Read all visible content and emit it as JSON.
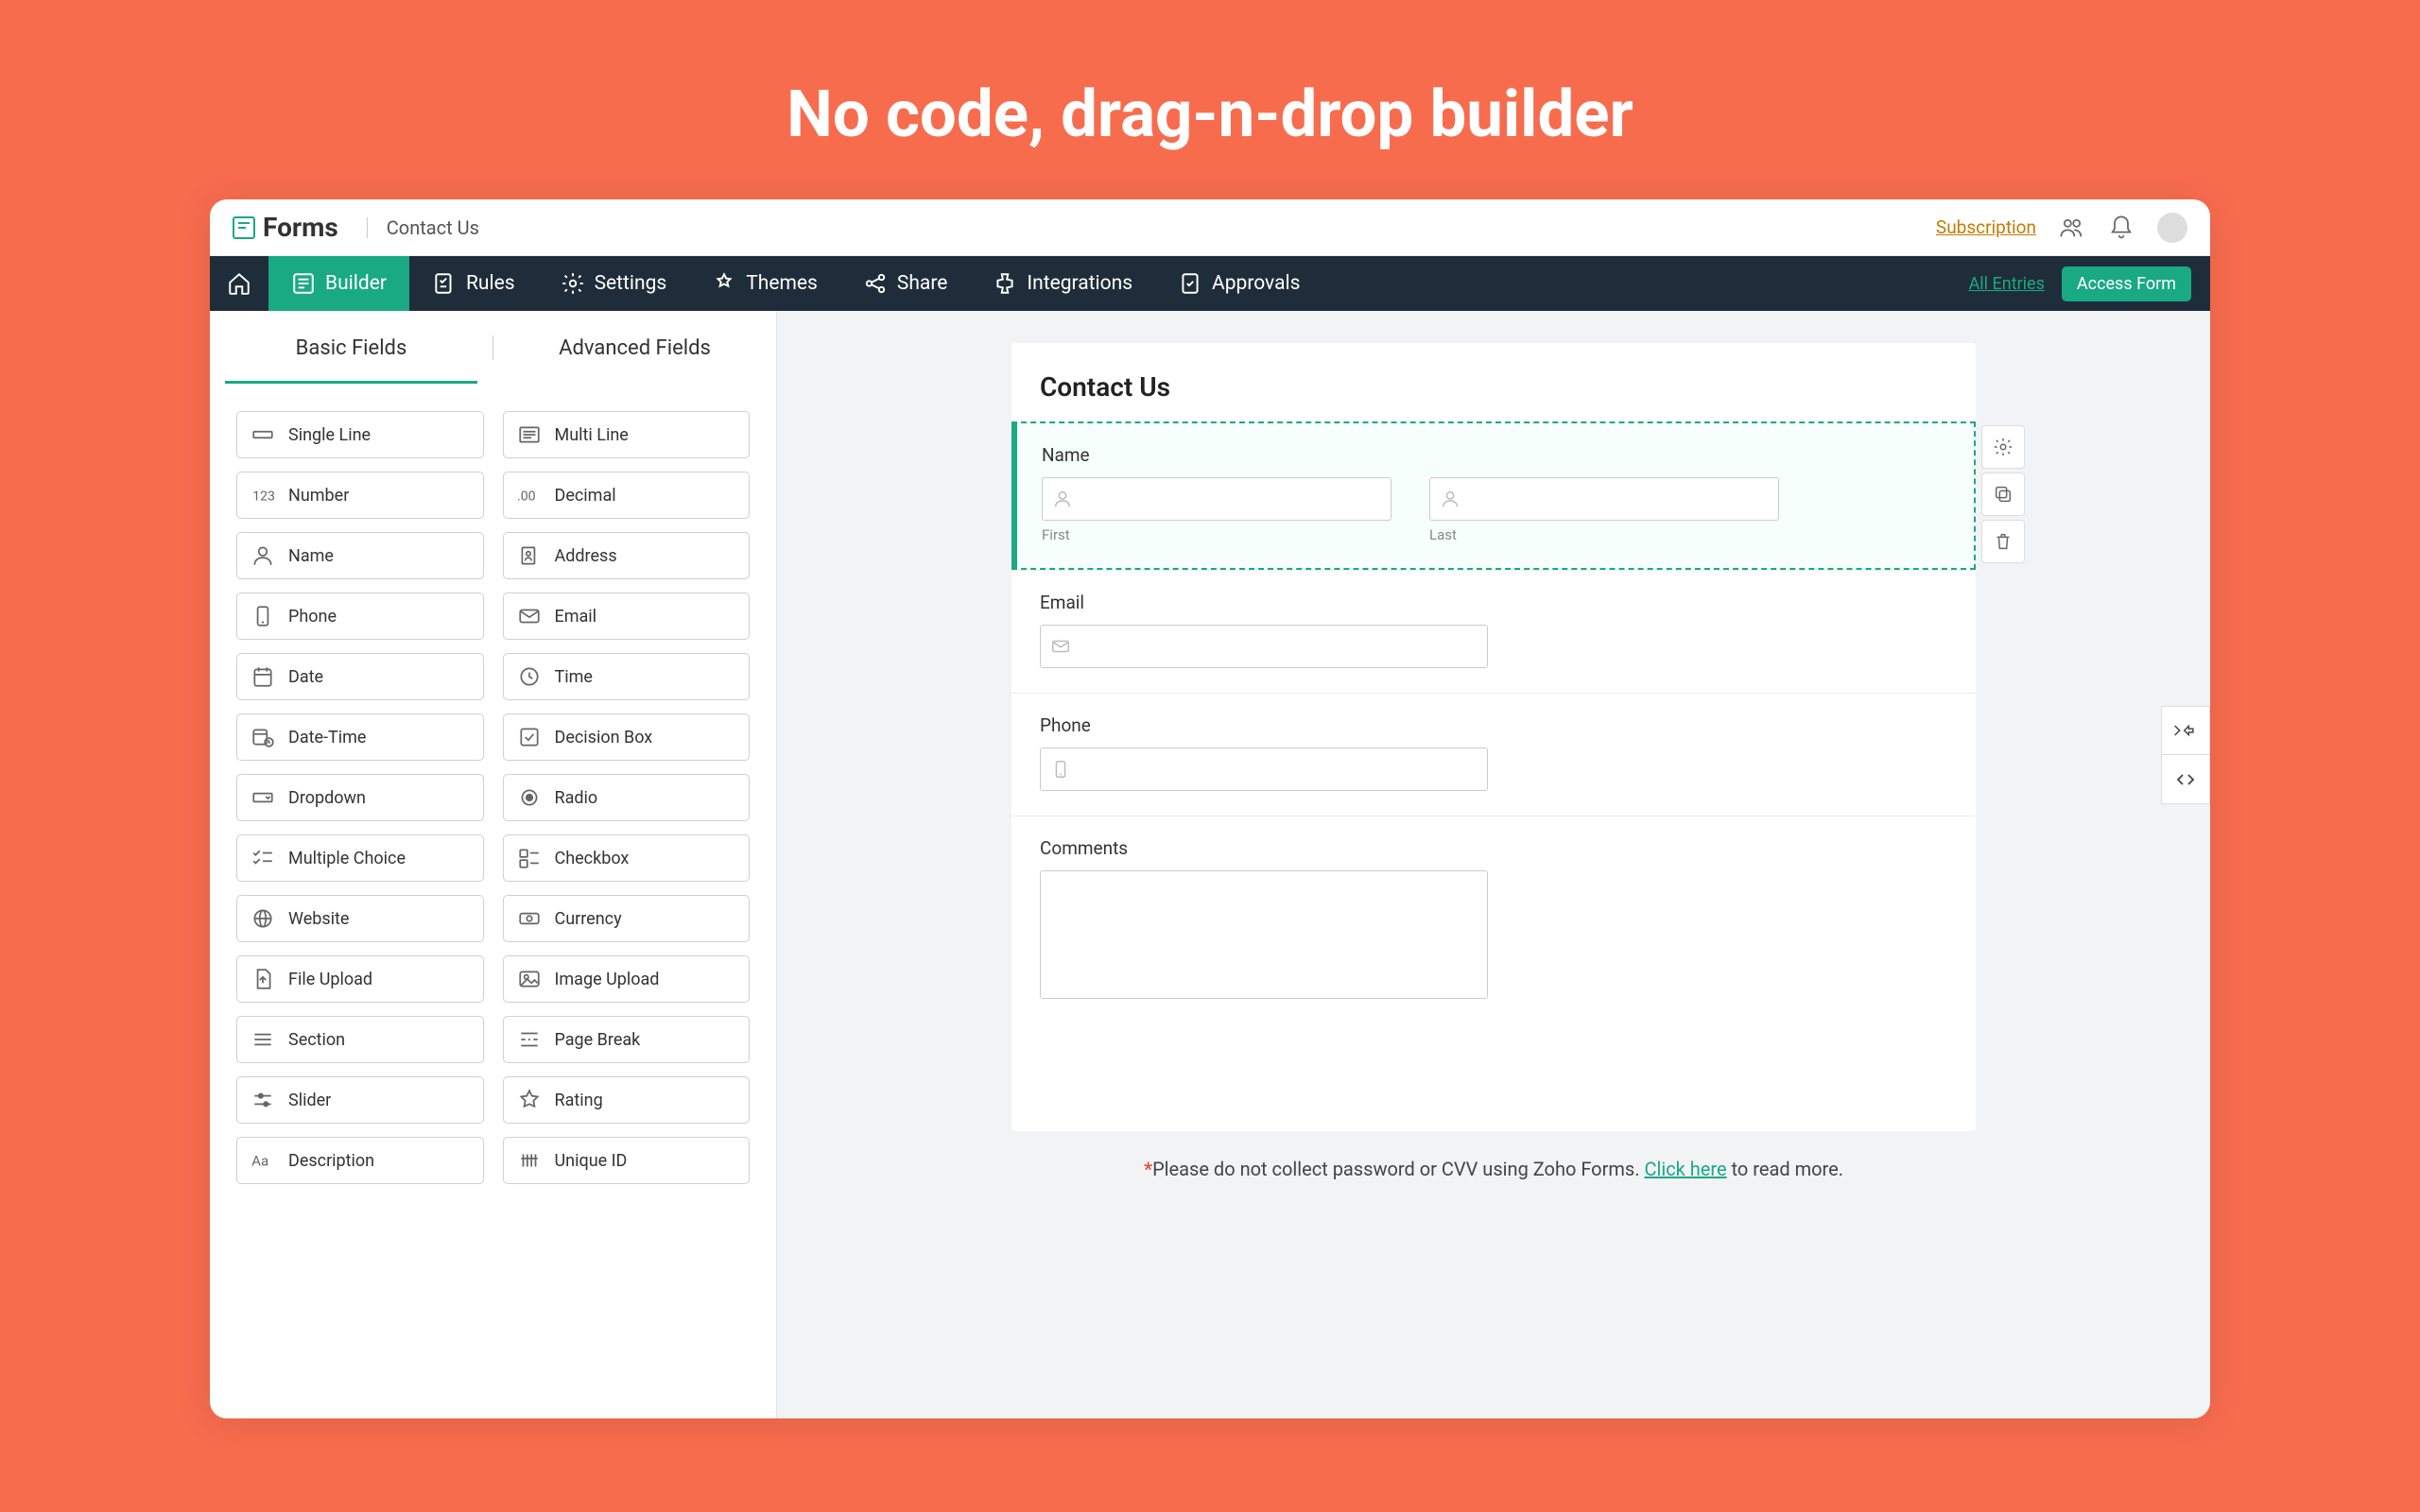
{
  "headline": "No code, drag-n-drop builder",
  "header": {
    "brand": "Forms",
    "breadcrumb": "Contact Us",
    "subscription": "Subscription"
  },
  "nav": {
    "items": [
      {
        "label": "Builder",
        "icon": "builder",
        "active": true
      },
      {
        "label": "Rules",
        "icon": "rules"
      },
      {
        "label": "Settings",
        "icon": "settings"
      },
      {
        "label": "Themes",
        "icon": "themes"
      },
      {
        "label": "Share",
        "icon": "share"
      },
      {
        "label": "Integrations",
        "icon": "integrations"
      },
      {
        "label": "Approvals",
        "icon": "approvals"
      }
    ],
    "all_entries": "All Entries",
    "access_form": "Access Form"
  },
  "sidebar": {
    "tabs": {
      "basic": "Basic Fields",
      "advanced": "Advanced Fields",
      "active": "basic"
    },
    "fields": [
      {
        "label": "Single Line",
        "icon": "single-line"
      },
      {
        "label": "Multi Line",
        "icon": "multi-line"
      },
      {
        "label": "Number",
        "icon": "number"
      },
      {
        "label": "Decimal",
        "icon": "decimal"
      },
      {
        "label": "Name",
        "icon": "name"
      },
      {
        "label": "Address",
        "icon": "address"
      },
      {
        "label": "Phone",
        "icon": "phone"
      },
      {
        "label": "Email",
        "icon": "email"
      },
      {
        "label": "Date",
        "icon": "date"
      },
      {
        "label": "Time",
        "icon": "time"
      },
      {
        "label": "Date-Time",
        "icon": "datetime"
      },
      {
        "label": "Decision Box",
        "icon": "decision"
      },
      {
        "label": "Dropdown",
        "icon": "dropdown"
      },
      {
        "label": "Radio",
        "icon": "radio"
      },
      {
        "label": "Multiple Choice",
        "icon": "multiple"
      },
      {
        "label": "Checkbox",
        "icon": "checkbox"
      },
      {
        "label": "Website",
        "icon": "website"
      },
      {
        "label": "Currency",
        "icon": "currency"
      },
      {
        "label": "File Upload",
        "icon": "file"
      },
      {
        "label": "Image Upload",
        "icon": "image"
      },
      {
        "label": "Section",
        "icon": "section"
      },
      {
        "label": "Page Break",
        "icon": "pagebreak"
      },
      {
        "label": "Slider",
        "icon": "slider"
      },
      {
        "label": "Rating",
        "icon": "rating"
      },
      {
        "label": "Description",
        "icon": "description"
      },
      {
        "label": "Unique ID",
        "icon": "uniqueid"
      }
    ]
  },
  "form": {
    "title": "Contact Us",
    "fields": {
      "name": {
        "label": "Name",
        "first": "First",
        "last": "Last"
      },
      "email": {
        "label": "Email"
      },
      "phone": {
        "label": "Phone"
      },
      "comments": {
        "label": "Comments"
      }
    }
  },
  "notice": {
    "star": "*",
    "text_a": "Please do not collect password or CVV using Zoho Forms. ",
    "link": "Click here",
    "text_b": " to read more."
  }
}
